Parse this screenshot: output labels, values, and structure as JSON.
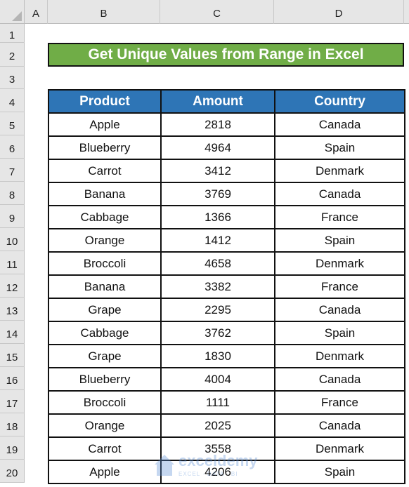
{
  "columns": [
    "A",
    "B",
    "C",
    "D"
  ],
  "rows": [
    "1",
    "2",
    "3",
    "4",
    "5",
    "6",
    "7",
    "8",
    "9",
    "10",
    "11",
    "12",
    "13",
    "14",
    "15",
    "16",
    "17",
    "18",
    "19",
    "20"
  ],
  "title": "Get Unique Values from Range in Excel",
  "table": {
    "headers": [
      "Product",
      "Amount",
      "Country"
    ],
    "rows": [
      [
        "Apple",
        "2818",
        "Canada"
      ],
      [
        "Blueberry",
        "4964",
        "Spain"
      ],
      [
        "Carrot",
        "3412",
        "Denmark"
      ],
      [
        "Banana",
        "3769",
        "Canada"
      ],
      [
        "Cabbage",
        "1366",
        "France"
      ],
      [
        "Orange",
        "1412",
        "Spain"
      ],
      [
        "Broccoli",
        "4658",
        "Denmark"
      ],
      [
        "Banana",
        "3382",
        "France"
      ],
      [
        "Grape",
        "2295",
        "Canada"
      ],
      [
        "Cabbage",
        "3762",
        "Spain"
      ],
      [
        "Grape",
        "1830",
        "Denmark"
      ],
      [
        "Blueberry",
        "4004",
        "Canada"
      ],
      [
        "Broccoli",
        "1111",
        "France"
      ],
      [
        "Orange",
        "2025",
        "Canada"
      ],
      [
        "Carrot",
        "3558",
        "Denmark"
      ],
      [
        "Apple",
        "4206",
        "Spain"
      ]
    ]
  },
  "watermark": {
    "brand": "exceldemy",
    "tagline": "EXCEL · DATA · BI"
  },
  "colors": {
    "title_bg": "#70ad47",
    "header_bg": "#2e75b6"
  }
}
